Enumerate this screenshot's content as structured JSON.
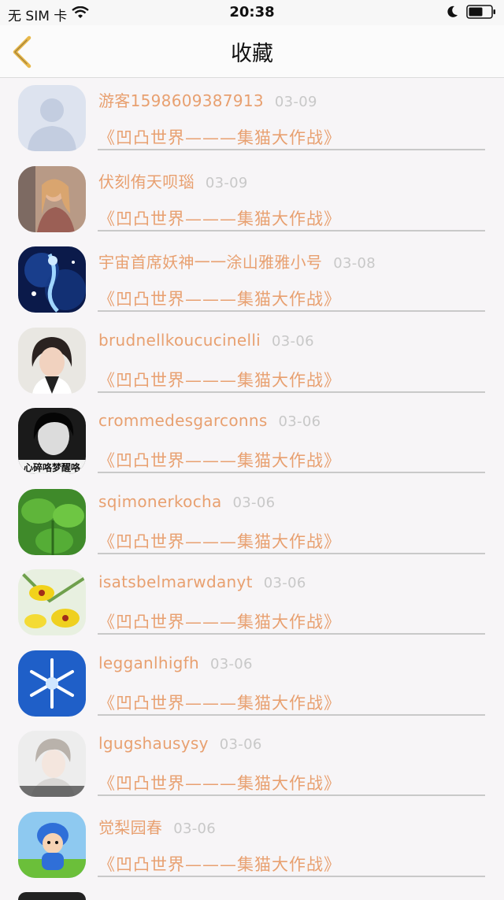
{
  "status_bar": {
    "carrier": "无 SIM 卡",
    "time": "20:38",
    "wifi_icon": "wifi-icon",
    "moon_icon": "moon-icon",
    "battery_icon": "battery-icon"
  },
  "header": {
    "title": "收藏",
    "back_icon": "chevron-left-icon",
    "accent_color": "#e8b84a"
  },
  "colors": {
    "name_text": "#e8a070",
    "date_text": "#c8c8c8",
    "divider": "#c9c9c9"
  },
  "items": [
    {
      "name": "游客1598609387913",
      "date": "03-09",
      "work": "《凹凸世界———集猫大作战》",
      "avatar": "default-user-avatar"
    },
    {
      "name": "伏刻侑天呗瑙",
      "date": "03-09",
      "work": "《凹凸世界———集猫大作战》",
      "avatar": "girl-photo-avatar"
    },
    {
      "name": "宇宙首席妖神一一涂山雅雅小号",
      "date": "03-08",
      "work": "《凹凸世界———集猫大作战》",
      "avatar": "blue-fairy-avatar"
    },
    {
      "name": "brudnellkoucucinelli",
      "date": "03-06",
      "work": "《凹凸世界———集猫大作战》",
      "avatar": "girl-smile-avatar"
    },
    {
      "name": "crommedesgarconns",
      "date": "03-06",
      "work": "《凹凸世界———集猫大作战》",
      "avatar": "bw-girl-avatar",
      "avatar_caption": "心碎咯梦醒咯"
    },
    {
      "name": "sqimonerkocha",
      "date": "03-06",
      "work": "《凹凸世界———集猫大作战》",
      "avatar": "green-clover-avatar"
    },
    {
      "name": "isatsbelmarwdanyt",
      "date": "03-06",
      "work": "《凹凸世界———集猫大作战》",
      "avatar": "yellow-orchid-avatar"
    },
    {
      "name": "legganlhigfh",
      "date": "03-06",
      "work": "《凹凸世界———集猫大作战》",
      "avatar": "snowflake-avatar"
    },
    {
      "name": "lgugshausysy",
      "date": "03-06",
      "work": "《凹凸世界———集猫大作战》",
      "avatar": "pale-boy-avatar"
    },
    {
      "name": "觉梨园春",
      "date": "03-06",
      "work": "《凹凸世界———集猫大作战》",
      "avatar": "blue-doll-avatar"
    }
  ]
}
